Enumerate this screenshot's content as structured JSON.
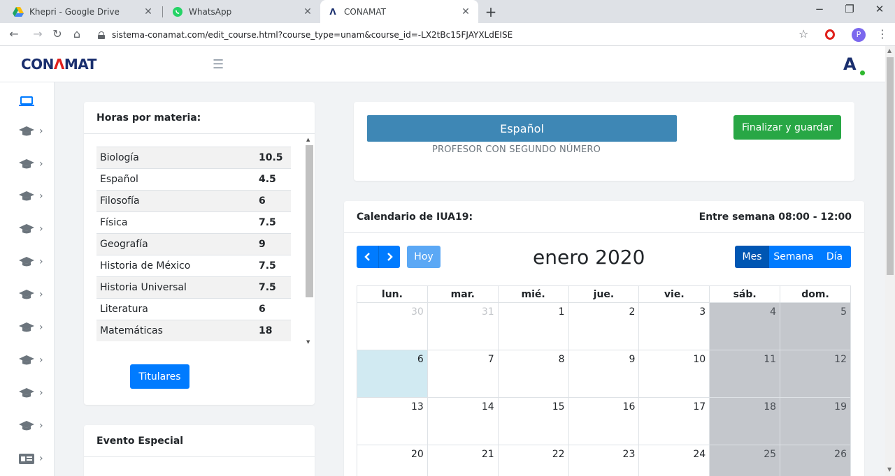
{
  "browser": {
    "tabs": [
      {
        "title": "Khepri - Google Drive",
        "icon": "google-drive-icon"
      },
      {
        "title": "WhatsApp",
        "icon": "whatsapp-icon"
      },
      {
        "title": "CONAMAT",
        "icon": "conamat-icon",
        "active": true
      }
    ],
    "url": "sistema-conamat.com/edit_course.html?course_type=unam&course_id=-LX2tBc15FJAYXLdEISE",
    "profile_initial": "P"
  },
  "header": {
    "logo_text_left": "CON",
    "logo_text_mid": "Λ",
    "logo_text_right": "MAT",
    "brand_letter": "A"
  },
  "hours": {
    "title": "Horas por materia:",
    "rows": [
      {
        "name": "Biología",
        "value": "10.5"
      },
      {
        "name": "Español",
        "value": "4.5"
      },
      {
        "name": "Filosofía",
        "value": "6"
      },
      {
        "name": "Física",
        "value": "7.5"
      },
      {
        "name": "Geografía",
        "value": "9"
      },
      {
        "name": "Historia de México",
        "value": "7.5"
      },
      {
        "name": "Historia Universal",
        "value": "7.5"
      },
      {
        "name": "Literatura",
        "value": "6"
      },
      {
        "name": "Matemáticas",
        "value": "18"
      }
    ],
    "titulares_label": "Titulares"
  },
  "evento": {
    "title": "Evento Especial"
  },
  "course": {
    "materia": "Español",
    "profesor": "PROFESOR CON SEGUNDO NÚMERO",
    "save_label": "Finalizar y guardar"
  },
  "calendar": {
    "title": "Calendario de IUA19:",
    "schedule": "Entre semana 08:00 - 12:00",
    "today_label": "Hoy",
    "month_label": "enero 2020",
    "views": [
      "Mes",
      "Semana",
      "Día"
    ],
    "active_view": "Mes",
    "weekdays": [
      "lun.",
      "mar.",
      "mié.",
      "jue.",
      "vie.",
      "sáb.",
      "dom."
    ],
    "weeks": [
      [
        "30",
        "31",
        "1",
        "2",
        "3",
        "4",
        "5"
      ],
      [
        "6",
        "7",
        "8",
        "9",
        "10",
        "11",
        "12"
      ],
      [
        "13",
        "14",
        "15",
        "16",
        "17",
        "18",
        "19"
      ],
      [
        "20",
        "21",
        "22",
        "23",
        "24",
        "25",
        "26"
      ]
    ],
    "colors": {
      "weekend": "#c4c7cc",
      "today": "#d1eaf2",
      "nav": "#007bff",
      "view_active": "#0056b3"
    }
  }
}
